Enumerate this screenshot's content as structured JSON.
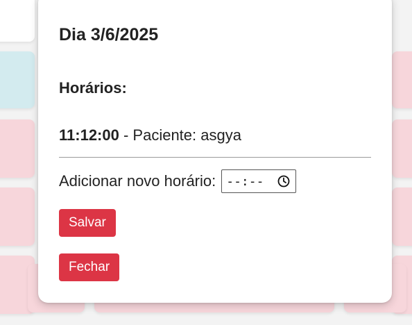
{
  "modal": {
    "title": "Dia 3/6/2025",
    "schedules_heading": "Horários:",
    "appointments": [
      {
        "time": "11:12:00",
        "separator": " - Paciente: ",
        "patient": "asgya"
      }
    ],
    "add_label": "Adicionar novo horário:",
    "time_input": {
      "display": "--:--",
      "icon": "clock-icon"
    },
    "save_label": "Salvar",
    "close_label": "Fechar"
  },
  "colors": {
    "button": "#dc3545",
    "cell_blue": "#d3ebef",
    "cell_pink": "#f7d6db",
    "text": "#222222"
  }
}
